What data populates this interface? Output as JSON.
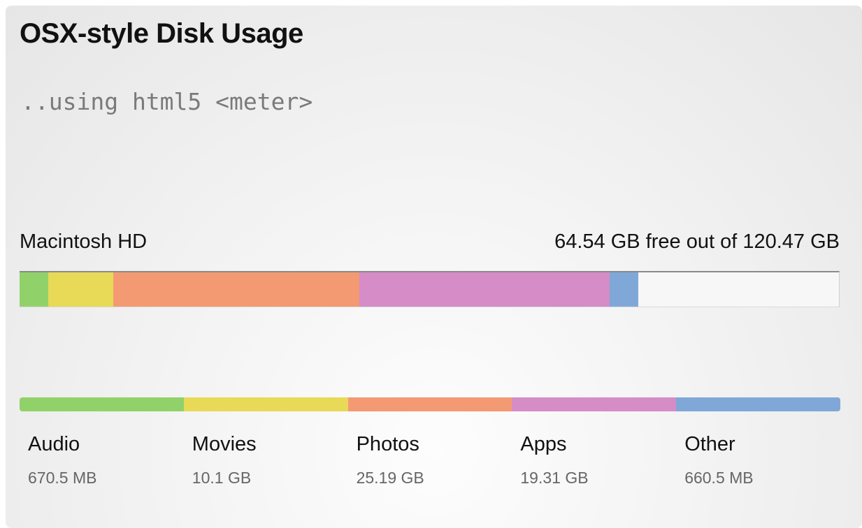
{
  "page": {
    "title": "OSX-style Disk Usage",
    "subtitle": "..using html5 <meter>"
  },
  "disk": {
    "name": "Macintosh HD",
    "free_text": "64.54 GB free out of 120.47 GB",
    "usage_fractions": {
      "audio": 0.035,
      "movies": 0.079,
      "photos": 0.301,
      "apps": 0.305,
      "other": 0.035
    }
  },
  "legend": [
    {
      "key": "audio",
      "label": "Audio",
      "value": "670.5 MB",
      "color": "#91d16a"
    },
    {
      "key": "movies",
      "label": "Movies",
      "value": "10.1 GB",
      "color": "#e8d957"
    },
    {
      "key": "photos",
      "label": "Photos",
      "value": "25.19 GB",
      "color": "#f39a72"
    },
    {
      "key": "apps",
      "label": "Apps",
      "value": "19.31 GB",
      "color": "#d58cc7"
    },
    {
      "key": "other",
      "label": "Other",
      "value": "660.5 MB",
      "color": "#7fa8d8"
    }
  ],
  "colors": {
    "free": "#f7f7f7",
    "title": "#111111",
    "subtitle": "#7a7a7a",
    "muted": "#666666"
  }
}
